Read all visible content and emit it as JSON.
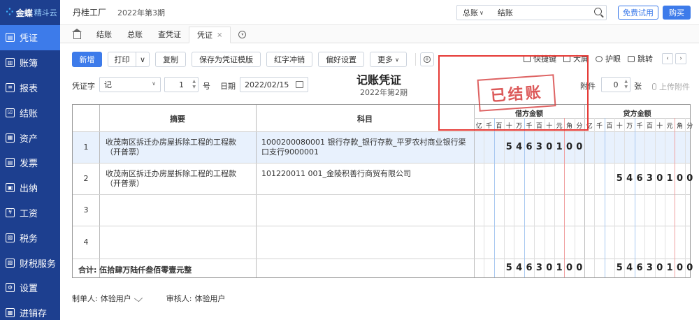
{
  "brand": {
    "name": "金蝶",
    "sub": "精斗云"
  },
  "sidebar": {
    "items": [
      {
        "label": "凭证",
        "icon": "voucher-icon",
        "glyph": "▤",
        "active": true
      },
      {
        "label": "账簿",
        "icon": "book-icon",
        "glyph": "▥"
      },
      {
        "label": "报表",
        "icon": "report-icon",
        "glyph": "≡"
      },
      {
        "label": "结账",
        "icon": "close-account-icon",
        "glyph": "☑"
      },
      {
        "label": "资产",
        "icon": "asset-icon",
        "glyph": "▦"
      },
      {
        "label": "发票",
        "icon": "invoice-icon",
        "glyph": "▤"
      },
      {
        "label": "出纳",
        "icon": "cashier-icon",
        "glyph": "▣"
      },
      {
        "label": "工资",
        "icon": "salary-icon",
        "glyph": "¥"
      },
      {
        "label": "税务",
        "icon": "tax-icon",
        "glyph": "▨"
      },
      {
        "label": "财税服务",
        "icon": "service-icon",
        "glyph": "▧"
      },
      {
        "label": "设置",
        "icon": "settings-icon",
        "glyph": "⚙"
      },
      {
        "label": "进销存",
        "icon": "inventory-icon",
        "glyph": "▩"
      }
    ]
  },
  "topbar": {
    "company": "丹桂工厂",
    "period": "2022年第3期",
    "search_type": "总账",
    "search_value": "结账",
    "trial_label": "免费试用",
    "buy_label": "购买"
  },
  "tabs": [
    {
      "label": "结账"
    },
    {
      "label": "总账"
    },
    {
      "label": "查凭证"
    },
    {
      "label": "凭证",
      "active": true
    }
  ],
  "toolbar": {
    "new": "新增",
    "print": "打印",
    "copy": "复制",
    "save_template": "保存为凭证模版",
    "red_reverse": "红字冲销",
    "preferences": "偏好设置",
    "more": "更多"
  },
  "right_tools": {
    "shortcut": "快捷键",
    "large": "大屏",
    "eye_care": "护眼",
    "jump": "跳转"
  },
  "form": {
    "word_label": "凭证字",
    "word_value": "记",
    "number_value": "1",
    "number_label": "号",
    "date_label": "日期",
    "date_value": "2022/02/15",
    "attach_label": "附件",
    "attach_value": "0",
    "attach_unit": "张",
    "upload_label": "上传附件"
  },
  "voucher": {
    "title": "记账凭证",
    "period": "2022年第2期",
    "stamp": "已结账"
  },
  "table": {
    "headers": {
      "summary": "摘要",
      "account": "科目",
      "debit": "借方金额",
      "credit": "贷方金额"
    },
    "digit_labels": [
      "亿",
      "千",
      "百",
      "十",
      "万",
      "千",
      "百",
      "十",
      "元",
      "角",
      "分"
    ],
    "rows": [
      {
        "no": "1",
        "summary": "收茂南区拆迁办房屋拆除工程的工程款（开普票）",
        "account": "1000200080001 银行存款_银行存款_平罗农村商业银行渠口支行9000001",
        "debit": "54630100",
        "credit": ""
      },
      {
        "no": "2",
        "summary": "收茂南区拆迁办房屋拆除工程的工程款（开普票）",
        "account": "101220011 001_金陵积善行商贸有限公司",
        "debit": "",
        "credit": "54630100"
      },
      {
        "no": "3",
        "summary": "",
        "account": "",
        "debit": "",
        "credit": ""
      },
      {
        "no": "4",
        "summary": "",
        "account": "",
        "debit": "",
        "credit": ""
      }
    ],
    "total_label": "合计: 伍拾肆万陆仟叁佰零壹元整",
    "total_debit": "54630100",
    "total_credit": "54630100"
  },
  "footer": {
    "maker_label": "制单人:",
    "maker": "体验用户",
    "reviewer_label": "审核人:",
    "reviewer": "体验用户"
  }
}
